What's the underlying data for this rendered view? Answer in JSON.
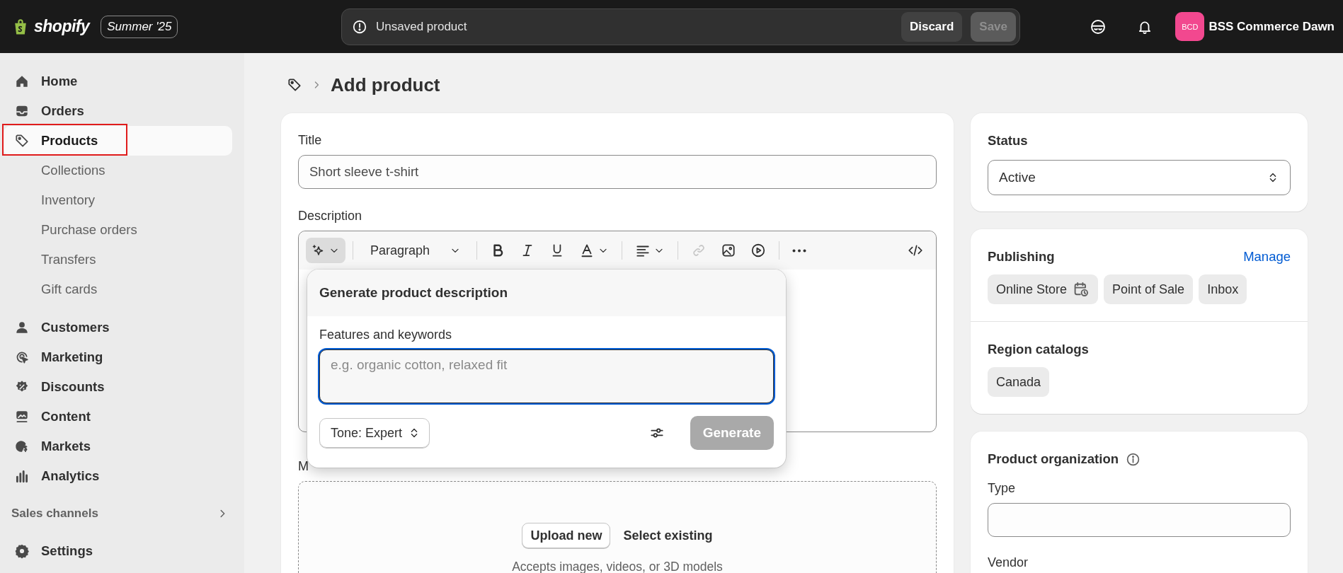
{
  "topbar": {
    "logo": "shopify",
    "edition": "Summer '25",
    "notice": "Unsaved product",
    "buttons": [
      {
        "label": "Discard",
        "disabled": false
      },
      {
        "label": "Save",
        "disabled": true
      }
    ],
    "avatar": "BCD",
    "store": "BSS Commerce Dawn"
  },
  "sidebar": {
    "items": [
      {
        "label": "Home",
        "selected": false,
        "highlighted": false
      },
      {
        "label": "Orders",
        "selected": false,
        "highlighted": false
      },
      {
        "label": "Products",
        "selected": true,
        "highlighted": true,
        "children": [
          {
            "label": "Collections",
            "selected": false
          },
          {
            "label": "Inventory",
            "selected": false
          },
          {
            "label": "Purchase orders",
            "selected": false
          },
          {
            "label": "Transfers",
            "selected": false
          },
          {
            "label": "Gift cards",
            "selected": false
          }
        ]
      },
      {
        "label": "Customers",
        "selected": false,
        "highlighted": false
      },
      {
        "label": "Marketing",
        "selected": false,
        "highlighted": false
      },
      {
        "label": "Discounts",
        "selected": false,
        "highlighted": false
      },
      {
        "label": "Content",
        "selected": false,
        "highlighted": false
      },
      {
        "label": "Markets",
        "selected": false,
        "highlighted": false
      },
      {
        "label": "Analytics",
        "selected": false,
        "highlighted": false
      }
    ],
    "section": "Sales channels",
    "settings": "Settings"
  },
  "page": {
    "title": "Add product"
  },
  "product_card": {
    "title_label": "Title",
    "title_value": "Short sleeve t-shirt",
    "description_label": "Description",
    "toolbar": {
      "ai_selected": true,
      "block_style": "Paragraph",
      "link_disabled": true
    },
    "ai_popover": {
      "title": "Generate product description",
      "field_label": "Features and keywords",
      "placeholder": "e.g. organic cotton, relaxed fit",
      "focused": true,
      "tone": "Tone: Expert",
      "generate": {
        "label": "Generate",
        "disabled": true
      }
    },
    "media_label": "M",
    "media": {
      "upload": "Upload new",
      "select": "Select existing",
      "hint": "Accepts images, videos, or 3D models"
    }
  },
  "status_card": {
    "label": "Status",
    "value": "Active"
  },
  "publishing_card": {
    "title": "Publishing",
    "action": "Manage",
    "channels": [
      {
        "label": "Online Store",
        "scheduled": true
      },
      {
        "label": "Point of Sale",
        "scheduled": false
      },
      {
        "label": "Inbox",
        "scheduled": false
      }
    ],
    "catalogs_title": "Region catalogs",
    "catalogs": [
      "Canada"
    ]
  },
  "organization_card": {
    "title": "Product organization",
    "type_label": "Type",
    "vendor_label": "Vendor"
  }
}
